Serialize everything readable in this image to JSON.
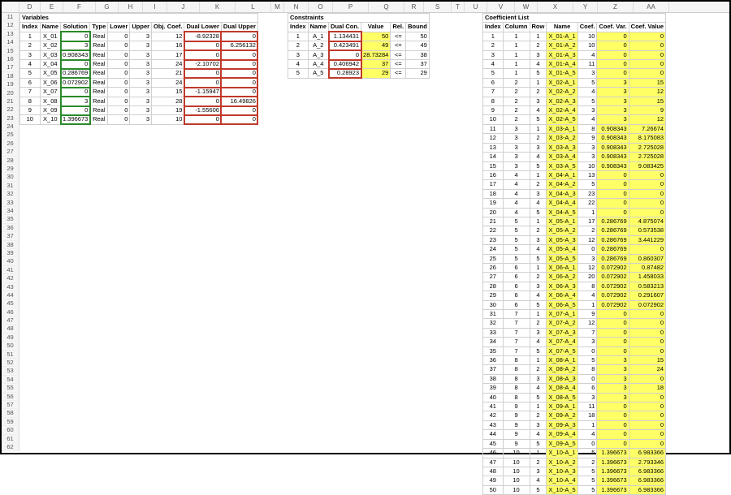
{
  "col_headers": [
    "D",
    "E",
    "F",
    "G",
    "H",
    "I",
    "J",
    "K",
    "L",
    "M",
    "N",
    "O",
    "P",
    "Q",
    "R",
    "S",
    "T",
    "U",
    "V",
    "W",
    "X",
    "Y",
    "Z",
    "AA"
  ],
  "row_start": 11,
  "row_end": 62,
  "sections": {
    "variables": {
      "title": "Variables",
      "headers": [
        "Index",
        "Name",
        "Solution",
        "Type",
        "Lower",
        "Upper",
        "Obj. Coef.",
        "Dual Lower",
        "Dual Upper"
      ]
    },
    "constraints": {
      "title": "Constraints",
      "headers": [
        "Index",
        "Name",
        "Dual Con.",
        "Value",
        "Rel.",
        "Bound"
      ]
    },
    "coefficients": {
      "title": "Coefficient List",
      "headers": [
        "Index",
        "Column",
        "Row",
        "Name",
        "Coef.",
        "Coef. Var.",
        "Coef. Value"
      ]
    }
  },
  "variables": [
    {
      "index": 1,
      "name": "X_01",
      "solution": 0,
      "type": "Real",
      "lower": 0,
      "upper": 3,
      "obj": 12,
      "dlow": -8.92328,
      "dup": 0
    },
    {
      "index": 2,
      "name": "X_02",
      "solution": 3,
      "type": "Real",
      "lower": 0,
      "upper": 3,
      "obj": 16,
      "dlow": 0,
      "dup": 6.256132
    },
    {
      "index": 3,
      "name": "X_03",
      "solution": 0.908343,
      "type": "Real",
      "lower": 0,
      "upper": 3,
      "obj": 17,
      "dlow": 0,
      "dup": 0
    },
    {
      "index": 4,
      "name": "X_04",
      "solution": 0,
      "type": "Real",
      "lower": 0,
      "upper": 3,
      "obj": 24,
      "dlow": -2.10702,
      "dup": 0
    },
    {
      "index": 5,
      "name": "X_05",
      "solution": 0.286769,
      "type": "Real",
      "lower": 0,
      "upper": 3,
      "obj": 21,
      "dlow": 0,
      "dup": 0
    },
    {
      "index": 6,
      "name": "X_06",
      "solution": 0.072902,
      "type": "Real",
      "lower": 0,
      "upper": 3,
      "obj": 24,
      "dlow": 0,
      "dup": 0
    },
    {
      "index": 7,
      "name": "X_07",
      "solution": 0,
      "type": "Real",
      "lower": 0,
      "upper": 3,
      "obj": 15,
      "dlow": -1.15947,
      "dup": 0
    },
    {
      "index": 8,
      "name": "X_08",
      "solution": 3,
      "type": "Real",
      "lower": 0,
      "upper": 3,
      "obj": 28,
      "dlow": 0,
      "dup": 16.49826
    },
    {
      "index": 9,
      "name": "X_09",
      "solution": 0,
      "type": "Real",
      "lower": 0,
      "upper": 3,
      "obj": 19,
      "dlow": -1.55606,
      "dup": 0
    },
    {
      "index": 10,
      "name": "X_10",
      "solution": 1.396673,
      "type": "Real",
      "lower": 0,
      "upper": 3,
      "obj": 10,
      "dlow": 0,
      "dup": 0
    }
  ],
  "constraints": [
    {
      "index": 1,
      "name": "A_1",
      "dual": 1.134431,
      "value": 50,
      "rel": "<=",
      "bound": 50
    },
    {
      "index": 2,
      "name": "A_2",
      "dual": 0.423491,
      "value": 49,
      "rel": "<=",
      "bound": 49
    },
    {
      "index": 3,
      "name": "A_3",
      "dual": 0,
      "value": 28.73284,
      "rel": "<=",
      "bound": 38
    },
    {
      "index": 4,
      "name": "A_4",
      "dual": 0.406942,
      "value": 37,
      "rel": "<=",
      "bound": 37
    },
    {
      "index": 5,
      "name": "A_5",
      "dual": 0.28923,
      "value": 29,
      "rel": "<=",
      "bound": 29
    }
  ],
  "coefficients": [
    {
      "i": 1,
      "c": 1,
      "r": 1,
      "n": "X_01-A_1",
      "co": 10,
      "cv": 0,
      "val": 0
    },
    {
      "i": 2,
      "c": 1,
      "r": 2,
      "n": "X_01-A_2",
      "co": 10,
      "cv": 0,
      "val": 0
    },
    {
      "i": 3,
      "c": 1,
      "r": 3,
      "n": "X_01-A_3",
      "co": 4,
      "cv": 0,
      "val": 0
    },
    {
      "i": 4,
      "c": 1,
      "r": 4,
      "n": "X_01-A_4",
      "co": 11,
      "cv": 0,
      "val": 0
    },
    {
      "i": 5,
      "c": 1,
      "r": 5,
      "n": "X_01-A_5",
      "co": 3,
      "cv": 0,
      "val": 0
    },
    {
      "i": 6,
      "c": 2,
      "r": 1,
      "n": "X_02-A_1",
      "co": 5,
      "cv": 3,
      "val": 15
    },
    {
      "i": 7,
      "c": 2,
      "r": 2,
      "n": "X_02-A_2",
      "co": 4,
      "cv": 3,
      "val": 12
    },
    {
      "i": 8,
      "c": 2,
      "r": 3,
      "n": "X_02-A_3",
      "co": 5,
      "cv": 3,
      "val": 15
    },
    {
      "i": 9,
      "c": 2,
      "r": 4,
      "n": "X_02-A_4",
      "co": 3,
      "cv": 3,
      "val": 9
    },
    {
      "i": 10,
      "c": 2,
      "r": 5,
      "n": "X_02-A_5",
      "co": 4,
      "cv": 3,
      "val": 12
    },
    {
      "i": 11,
      "c": 3,
      "r": 1,
      "n": "X_03-A_1",
      "co": 8,
      "cv": 0.908343,
      "val": 7.26674
    },
    {
      "i": 12,
      "c": 3,
      "r": 2,
      "n": "X_03-A_2",
      "co": 9,
      "cv": 0.908343,
      "val": 8.175083
    },
    {
      "i": 13,
      "c": 3,
      "r": 3,
      "n": "X_03-A_3",
      "co": 3,
      "cv": 0.908343,
      "val": 2.725028
    },
    {
      "i": 14,
      "c": 3,
      "r": 4,
      "n": "X_03-A_4",
      "co": 3,
      "cv": 0.908343,
      "val": 2.725028
    },
    {
      "i": 15,
      "c": 3,
      "r": 5,
      "n": "X_03-A_5",
      "co": 10,
      "cv": 0.908343,
      "val": 9.083425
    },
    {
      "i": 16,
      "c": 4,
      "r": 1,
      "n": "X_04-A_1",
      "co": 13,
      "cv": 0,
      "val": 0
    },
    {
      "i": 17,
      "c": 4,
      "r": 2,
      "n": "X_04-A_2",
      "co": 5,
      "cv": 0,
      "val": 0
    },
    {
      "i": 18,
      "c": 4,
      "r": 3,
      "n": "X_04-A_3",
      "co": 23,
      "cv": 0,
      "val": 0
    },
    {
      "i": 19,
      "c": 4,
      "r": 4,
      "n": "X_04-A_4",
      "co": 22,
      "cv": 0,
      "val": 0
    },
    {
      "i": 20,
      "c": 4,
      "r": 5,
      "n": "X_04-A_5",
      "co": 1,
      "cv": 0,
      "val": 0
    },
    {
      "i": 21,
      "c": 5,
      "r": 1,
      "n": "X_05-A_1",
      "co": 17,
      "cv": 0.286769,
      "val": 4.875074
    },
    {
      "i": 22,
      "c": 5,
      "r": 2,
      "n": "X_05-A_2",
      "co": 2,
      "cv": 0.286769,
      "val": 0.573538
    },
    {
      "i": 23,
      "c": 5,
      "r": 3,
      "n": "X_05-A_3",
      "co": 12,
      "cv": 0.286769,
      "val": 3.441229
    },
    {
      "i": 24,
      "c": 5,
      "r": 4,
      "n": "X_05-A_4",
      "co": 0,
      "cv": 0.286769,
      "val": 0
    },
    {
      "i": 25,
      "c": 5,
      "r": 5,
      "n": "X_05-A_5",
      "co": 3,
      "cv": 0.286769,
      "val": 0.860307
    },
    {
      "i": 26,
      "c": 6,
      "r": 1,
      "n": "X_06-A_1",
      "co": 12,
      "cv": 0.072902,
      "val": 0.87482
    },
    {
      "i": 27,
      "c": 6,
      "r": 2,
      "n": "X_06-A_2",
      "co": 20,
      "cv": 0.072902,
      "val": 1.458033
    },
    {
      "i": 28,
      "c": 6,
      "r": 3,
      "n": "X_06-A_3",
      "co": 8,
      "cv": 0.072902,
      "val": 0.583213
    },
    {
      "i": 29,
      "c": 6,
      "r": 4,
      "n": "X_06-A_4",
      "co": 4,
      "cv": 0.072902,
      "val": 0.291607
    },
    {
      "i": 30,
      "c": 6,
      "r": 5,
      "n": "X_06-A_5",
      "co": 1,
      "cv": 0.072902,
      "val": 0.072902
    },
    {
      "i": 31,
      "c": 7,
      "r": 1,
      "n": "X_07-A_1",
      "co": 9,
      "cv": 0,
      "val": 0
    },
    {
      "i": 32,
      "c": 7,
      "r": 2,
      "n": "X_07-A_2",
      "co": 12,
      "cv": 0,
      "val": 0
    },
    {
      "i": 33,
      "c": 7,
      "r": 3,
      "n": "X_07-A_3",
      "co": 7,
      "cv": 0,
      "val": 0
    },
    {
      "i": 34,
      "c": 7,
      "r": 4,
      "n": "X_07-A_4",
      "co": 3,
      "cv": 0,
      "val": 0
    },
    {
      "i": 35,
      "c": 7,
      "r": 5,
      "n": "X_07-A_5",
      "co": 0,
      "cv": 0,
      "val": 0
    },
    {
      "i": 36,
      "c": 8,
      "r": 1,
      "n": "X_08-A_1",
      "co": 5,
      "cv": 3,
      "val": 15
    },
    {
      "i": 37,
      "c": 8,
      "r": 2,
      "n": "X_08-A_2",
      "co": 8,
      "cv": 3,
      "val": 24
    },
    {
      "i": 38,
      "c": 8,
      "r": 3,
      "n": "X_08-A_3",
      "co": 0,
      "cv": 3,
      "val": 0
    },
    {
      "i": 39,
      "c": 8,
      "r": 4,
      "n": "X_08-A_4",
      "co": 6,
      "cv": 3,
      "val": 18
    },
    {
      "i": 40,
      "c": 8,
      "r": 5,
      "n": "X_08-A_5",
      "co": 3,
      "cv": 3,
      "val": 0
    },
    {
      "i": 41,
      "c": 9,
      "r": 1,
      "n": "X_09-A_1",
      "co": 11,
      "cv": 0,
      "val": 0
    },
    {
      "i": 42,
      "c": 9,
      "r": 2,
      "n": "X_09-A_2",
      "co": 18,
      "cv": 0,
      "val": 0
    },
    {
      "i": 43,
      "c": 9,
      "r": 3,
      "n": "X_09-A_3",
      "co": 1,
      "cv": 0,
      "val": 0
    },
    {
      "i": 44,
      "c": 9,
      "r": 4,
      "n": "X_09-A_4",
      "co": 4,
      "cv": 0,
      "val": 0
    },
    {
      "i": 45,
      "c": 9,
      "r": 5,
      "n": "X_09-A_5",
      "co": 0,
      "cv": 0,
      "val": 0
    },
    {
      "i": 46,
      "c": 10,
      "r": 1,
      "n": "X_10-A_1",
      "co": 5,
      "cv": 1.396673,
      "val": 6.983366
    },
    {
      "i": 47,
      "c": 10,
      "r": 2,
      "n": "X_10-A_2",
      "co": 2,
      "cv": 1.396673,
      "val": 2.793346
    },
    {
      "i": 48,
      "c": 10,
      "r": 3,
      "n": "X_10-A_3",
      "co": 5,
      "cv": 1.396673,
      "val": 6.983366
    },
    {
      "i": 49,
      "c": 10,
      "r": 4,
      "n": "X_10-A_4",
      "co": 5,
      "cv": 1.396673,
      "val": 6.983366
    },
    {
      "i": 50,
      "c": 10,
      "r": 5,
      "n": "X_10-A_5",
      "co": 5,
      "cv": 1.396673,
      "val": 6.983366
    }
  ]
}
